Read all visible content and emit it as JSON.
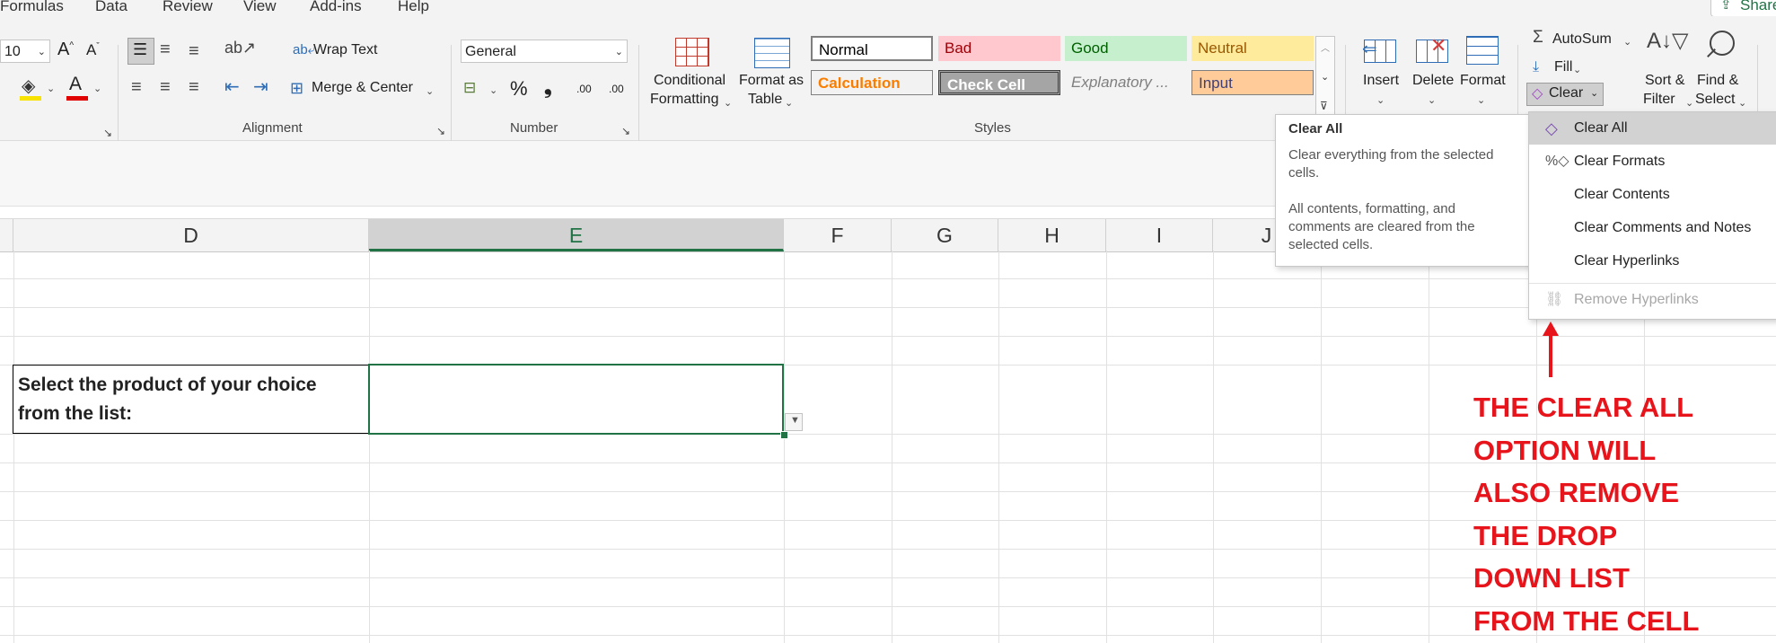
{
  "menu": {
    "items": [
      "Formulas",
      "Data",
      "Review",
      "View",
      "Add-ins",
      "Help"
    ],
    "share": "Share"
  },
  "font": {
    "size": "10"
  },
  "alignment": {
    "wrap_text": "Wrap Text",
    "merge_center": "Merge & Center",
    "label": "Alignment"
  },
  "number": {
    "format": "General",
    "label": "Number",
    "percent": "%",
    "comma": "❟",
    "increase_decimal": ".00",
    "decrease_decimal": ".00"
  },
  "styles": {
    "conditional_formatting": [
      "Conditional",
      "Formatting"
    ],
    "format_as_table": [
      "Format as",
      "Table"
    ],
    "cells": [
      {
        "label": "Normal",
        "bg": "#ffffff",
        "fg": "#000000",
        "border": "#7f7f7f"
      },
      {
        "label": "Bad",
        "bg": "#ffc7ce",
        "fg": "#9c0006"
      },
      {
        "label": "Good",
        "bg": "#c6efce",
        "fg": "#006100"
      },
      {
        "label": "Neutral",
        "bg": "#ffeb9c",
        "fg": "#9c5700"
      },
      {
        "label": "Calculation",
        "bg": "#f2f2f2",
        "fg": "#fa7d00",
        "border": "#7f7f7f"
      },
      {
        "label": "Check Cell",
        "bg": "#a5a5a5",
        "fg": "#ffffff",
        "border": "#3f3f3f"
      },
      {
        "label": "Explanatory ...",
        "bg": "#f3f3f3",
        "fg": "#7f7f7f"
      },
      {
        "label": "Input",
        "bg": "#ffcc99",
        "fg": "#3f3f76",
        "border": "#7f7f7f"
      }
    ],
    "label": "Styles"
  },
  "cells_group": {
    "insert": "Insert",
    "delete": "Delete",
    "format": "Format"
  },
  "editing": {
    "autosum": "AutoSum",
    "fill": "Fill",
    "clear": "Clear",
    "sort_filter": [
      "Sort &",
      "Filter"
    ],
    "find_select": [
      "Find &",
      "Select"
    ]
  },
  "columns": [
    "D",
    "E",
    "F",
    "G",
    "H",
    "I",
    "J"
  ],
  "sheet": {
    "label_line1": "Select the product of your choice",
    "label_line2": "from the list:"
  },
  "tooltip": {
    "title": "Clear All",
    "line1": "Clear everything from the selected",
    "line2": "cells.",
    "line3": "All contents, formatting, and",
    "line4": "comments are cleared from the",
    "line5": "selected cells."
  },
  "clear_menu": {
    "items": [
      "Clear All",
      "Clear Formats",
      "Clear Contents",
      "Clear Comments and Notes",
      "Clear Hyperlinks",
      "Remove Hyperlinks"
    ]
  },
  "annotation": {
    "lines": [
      "THE CLEAR ALL",
      "OPTION WILL",
      "ALSO REMOVE",
      "THE DROP",
      "DOWN LIST",
      "FROM THE CELL"
    ],
    "color": "#e8141b"
  },
  "colors": {
    "accent": "#217346",
    "ribbon_bg": "#f3f3f3",
    "selection_bg": "#d2d2d2"
  }
}
